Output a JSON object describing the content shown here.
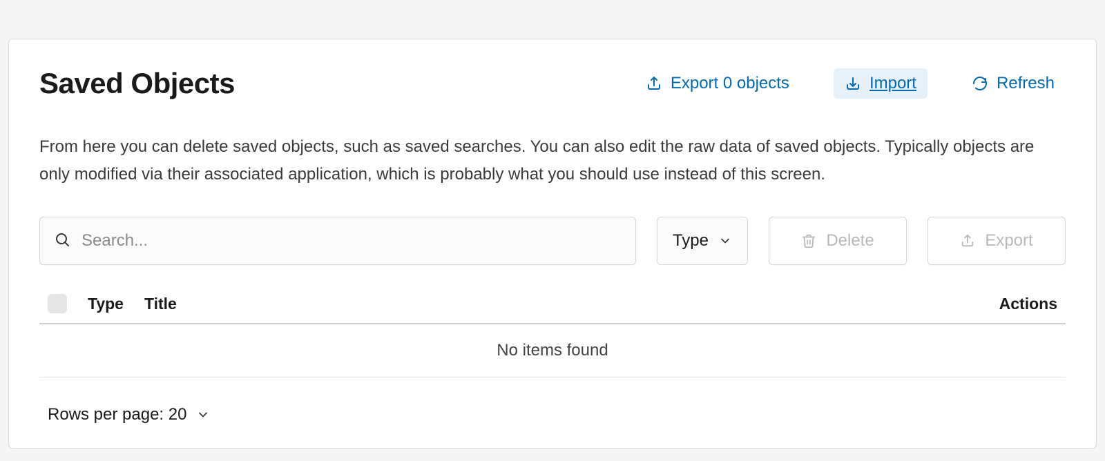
{
  "header": {
    "title": "Saved Objects",
    "export_label": "Export 0 objects",
    "import_label": "Import",
    "refresh_label": "Refresh"
  },
  "description": "From here you can delete saved objects, such as saved searches. You can also edit the raw data of saved objects. Typically objects are only modified via their associated application, which is probably what you should use instead of this screen.",
  "search": {
    "placeholder": "Search..."
  },
  "toolbar": {
    "type_filter_label": "Type",
    "delete_label": "Delete",
    "export_label": "Export"
  },
  "table": {
    "columns": {
      "type": "Type",
      "title": "Title",
      "actions": "Actions"
    },
    "empty_message": "No items found"
  },
  "pagination": {
    "rows_per_page_label": "Rows per page: 20"
  }
}
